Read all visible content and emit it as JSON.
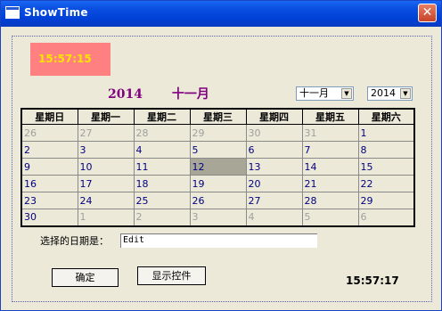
{
  "window": {
    "title": "ShowTime",
    "close_glyph": "✕"
  },
  "clock_top": "15:57:15",
  "calendar": {
    "year": "2014",
    "month": "十一月",
    "month_select": {
      "selected": "十一月"
    },
    "year_select": {
      "selected": "2014"
    },
    "weekdays": [
      "星期日",
      "星期一",
      "星期二",
      "星期三",
      "星期四",
      "星期五",
      "星期六"
    ],
    "weeks": [
      [
        {
          "d": "26",
          "o": true
        },
        {
          "d": "27",
          "o": true
        },
        {
          "d": "28",
          "o": true
        },
        {
          "d": "29",
          "o": true
        },
        {
          "d": "30",
          "o": true
        },
        {
          "d": "31",
          "o": true
        },
        {
          "d": "1"
        }
      ],
      [
        {
          "d": "2"
        },
        {
          "d": "3"
        },
        {
          "d": "4"
        },
        {
          "d": "5"
        },
        {
          "d": "6"
        },
        {
          "d": "7"
        },
        {
          "d": "8"
        }
      ],
      [
        {
          "d": "9"
        },
        {
          "d": "10"
        },
        {
          "d": "11"
        },
        {
          "d": "12",
          "s": true
        },
        {
          "d": "13"
        },
        {
          "d": "14"
        },
        {
          "d": "15"
        }
      ],
      [
        {
          "d": "16"
        },
        {
          "d": "17"
        },
        {
          "d": "18"
        },
        {
          "d": "19"
        },
        {
          "d": "20"
        },
        {
          "d": "21"
        },
        {
          "d": "22"
        }
      ],
      [
        {
          "d": "23"
        },
        {
          "d": "24"
        },
        {
          "d": "25"
        },
        {
          "d": "26"
        },
        {
          "d": "27"
        },
        {
          "d": "28"
        },
        {
          "d": "29"
        }
      ],
      [
        {
          "d": "30"
        },
        {
          "d": "1",
          "o": true
        },
        {
          "d": "2",
          "o": true
        },
        {
          "d": "3",
          "o": true
        },
        {
          "d": "4",
          "o": true
        },
        {
          "d": "5",
          "o": true
        },
        {
          "d": "6",
          "o": true
        }
      ]
    ]
  },
  "selected_date": {
    "label": "选择的日期是：",
    "value": "Edit"
  },
  "buttons": {
    "ok": "确定",
    "show_controls": "显示控件"
  },
  "clock_bottom": "15:57:17",
  "colors": {
    "title_bar": "#0040d6",
    "clock_bg": "#ff8080",
    "clock_text": "#ffe400",
    "header_text": "#800080",
    "day_text": "#000080",
    "other_day_text": "#a0a0a0",
    "selected_day_bg": "#a8a697"
  }
}
